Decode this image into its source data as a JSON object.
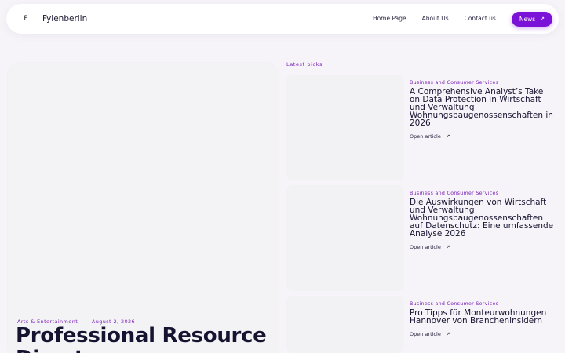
{
  "header": {
    "logo_mark": "F",
    "brand": "Fylenberlin",
    "nav": {
      "home": "Home Page",
      "about": "About Us",
      "contact": "Contact us",
      "news": "News",
      "news_icon": "arrow-up-right-icon"
    }
  },
  "hero": {
    "category": "Arts & Entertainment",
    "separator": "-",
    "date": "August 2, 2026",
    "title": "Professional Resource Directory"
  },
  "latest": {
    "heading": "Latest picks",
    "items": [
      {
        "category": "Business and Consumer Services",
        "title": "A Comprehensive Analyst’s Take on Data Protection in Wirtschaft und Verwaltung Wohnungsbaugenossenschaften in 2026",
        "link": "Open article"
      },
      {
        "category": "Business and Consumer Services",
        "title": "Die Auswirkungen von Wirtschaft und Verwaltung Wohnungsbaugenossenschaften auf Datenschutz: Eine umfassende Analyse 2026",
        "link": "Open article"
      },
      {
        "category": "Business and Consumer Services",
        "title": "Pro Tipps für Monteurwohnungen Hannover von Brancheninsidern",
        "link": "Open article"
      }
    ]
  },
  "colors": {
    "accent": "#7a12d8",
    "accent_text": "#7a20b8",
    "background": "#f6f4f8"
  }
}
